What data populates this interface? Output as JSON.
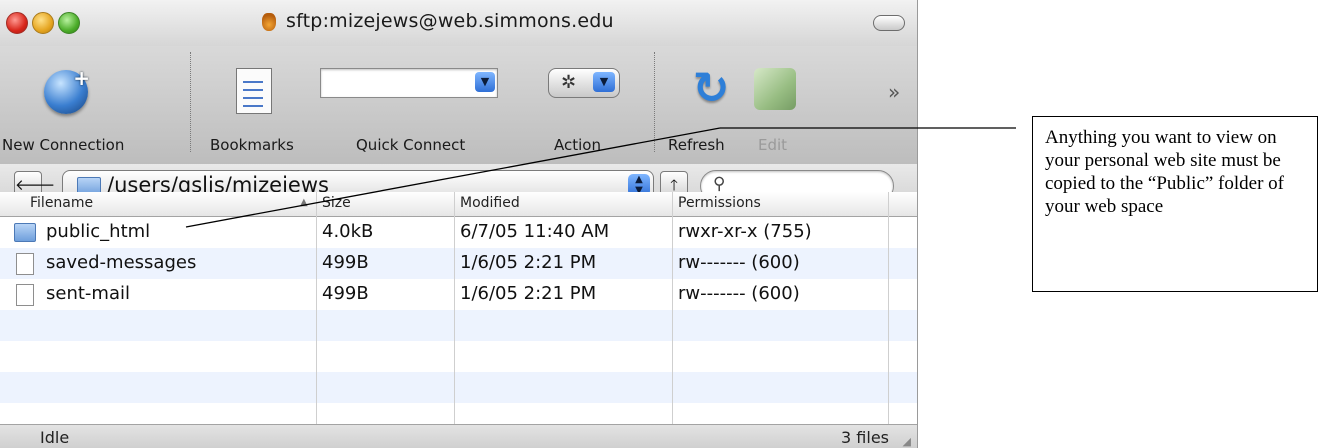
{
  "window": {
    "title": "sftp:mizejews@web.simmons.edu"
  },
  "toolbar": {
    "new_connection": "New Connection",
    "bookmarks": "Bookmarks",
    "quick_connect": "Quick Connect",
    "action": "Action",
    "refresh": "Refresh",
    "edit": "Edit",
    "overflow": "»"
  },
  "pathbar": {
    "path": "/users/gslis/mizejews"
  },
  "table": {
    "columns": [
      "Filename",
      "Size",
      "Modified",
      "Permissions"
    ],
    "rows": [
      {
        "name": "public_html",
        "size": "4.0kB",
        "modified": "6/7/05 11:40 AM",
        "permissions": "rwxr-xr-x (755)",
        "icon": "folder-icon"
      },
      {
        "name": "saved-messages",
        "size": "499B",
        "modified": "1/6/05 2:21 PM",
        "permissions": "rw------- (600)",
        "icon": "file-icon"
      },
      {
        "name": "sent-mail",
        "size": "499B",
        "modified": "1/6/05 2:21 PM",
        "permissions": "rw------- (600)",
        "icon": "file-icon"
      }
    ]
  },
  "status": {
    "left": "Idle",
    "right": "3 files"
  },
  "annotation": {
    "text": "Anything you want to view on your personal web site must be copied to the “Public” folder of your web space"
  },
  "colors": {
    "row_alt": "#edf3fe",
    "row": "#ffffff"
  }
}
